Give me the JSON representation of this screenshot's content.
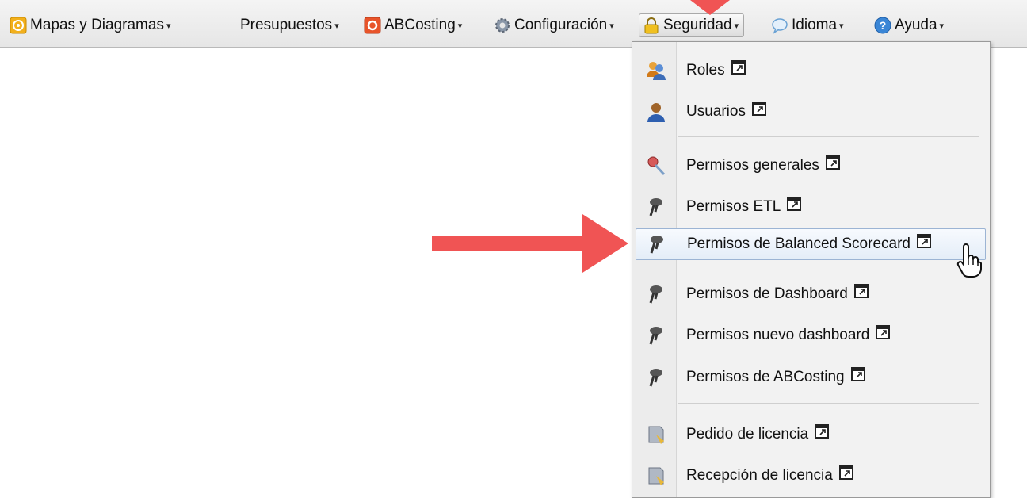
{
  "menubar": {
    "items": [
      {
        "label": "Mapas y Diagramas",
        "icon": "maps-icon"
      },
      {
        "label": "Presupuestos",
        "icon": ""
      },
      {
        "label": "ABCosting",
        "icon": "abcosting-icon"
      },
      {
        "label": "Configuración",
        "icon": "gear-icon"
      },
      {
        "label": "Seguridad",
        "icon": "lock-icon",
        "active": true
      },
      {
        "label": "Idioma",
        "icon": "speech-bubble-icon"
      },
      {
        "label": "Ayuda",
        "icon": "help-icon"
      }
    ]
  },
  "dropdown": {
    "items": [
      {
        "label": "Roles",
        "icon": "roles-icon"
      },
      {
        "label": "Usuarios",
        "icon": "user-icon"
      },
      {
        "label": "Permisos generales",
        "icon": "key-icon"
      },
      {
        "label": "Permisos ETL",
        "icon": "key-icon"
      },
      {
        "label": "Permisos de Balanced Scorecard",
        "icon": "key-icon",
        "hovered": true
      },
      {
        "label": "Permisos de Dashboard",
        "icon": "key-icon"
      },
      {
        "label": "Permisos nuevo dashboard",
        "icon": "key-icon"
      },
      {
        "label": "Permisos de ABCosting",
        "icon": "key-icon"
      },
      {
        "label": "Pedido de licencia",
        "icon": "license-icon"
      },
      {
        "label": "Recepción de licencia",
        "icon": "license-icon"
      }
    ]
  },
  "colors": {
    "annotation_arrow": "#f05454",
    "hover_border": "#9cb4d4"
  }
}
